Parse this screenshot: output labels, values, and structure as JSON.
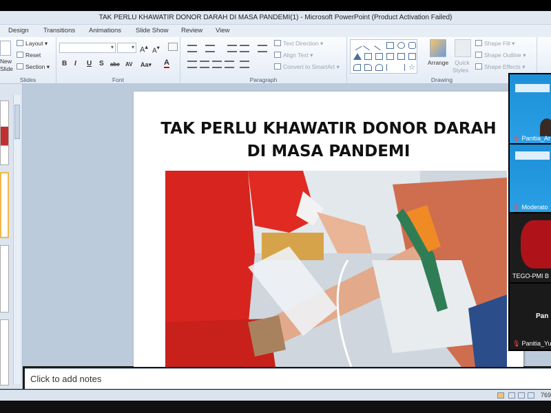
{
  "window": {
    "title": "TAK PERLU KHAWATIR DONOR DARAH DI MASA PANDEMI(1)  -  Microsoft PowerPoint (Product Activation Failed)"
  },
  "menu": [
    "Design",
    "Transitions",
    "Animations",
    "Slide Show",
    "Review",
    "View"
  ],
  "ribbon": {
    "slides": {
      "label": "Slides",
      "new_slide_top": "New",
      "new_slide_bottom": "Slide",
      "layout": "Layout",
      "reset": "Reset",
      "section": "Section"
    },
    "font": {
      "label": "Font"
    },
    "paragraph": {
      "label": "Paragraph",
      "text_direction": "Text Direction",
      "align_text": "Align Text",
      "convert_smartart": "Convert to SmartArt"
    },
    "drawing": {
      "label": "Drawing",
      "arrange": "Arrange",
      "quick_styles_top": "Quick",
      "quick_styles_bottom": "Styles",
      "shape_fill": "Shape Fill",
      "shape_outline": "Shape Outline",
      "shape_effects": "Shape Effects"
    }
  },
  "slide": {
    "title_line1": "TAK PERLU KHAWATIR DONOR DARAH",
    "title_line2": "DI MASA PANDEMI"
  },
  "notes": {
    "placeholder": "Click to add notes"
  },
  "status": {
    "zoom": "769"
  },
  "participants": [
    {
      "name": "Panitia_Ar"
    },
    {
      "name": "Moderato"
    },
    {
      "name": "TEGO-PMI B"
    },
    {
      "name": "Pan"
    },
    {
      "name": "Panitia_Yu"
    }
  ],
  "colors": {
    "accent": "#2b579a",
    "ribbon_bg": "#e3ebf5",
    "video_blue": "#1f8fd6",
    "mic_muted": "#ff4b4b"
  }
}
